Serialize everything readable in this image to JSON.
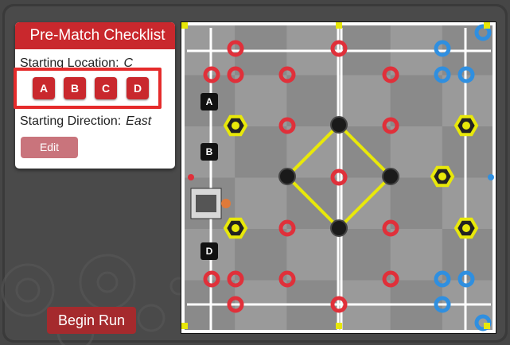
{
  "checklist": {
    "title": "Pre-Match Checklist",
    "starting_location_label": "Starting Location:",
    "starting_location_value": "C",
    "starting_direction_label": "Starting Direction:",
    "starting_direction_value": "East",
    "edit_label": "Edit"
  },
  "location_buttons": [
    "A",
    "B",
    "C",
    "D"
  ],
  "field_start_labels": [
    "A",
    "B",
    "D"
  ],
  "begin_run_label": "Begin Run",
  "colors": {
    "accent_red": "#c9282d",
    "highlight": "#e52b2b",
    "field_background": "#8a8a8a",
    "line_white": "#ffffff",
    "line_yellow": "#e8e80a",
    "ring_red": "#e0303a",
    "ring_blue": "#2f8fe0",
    "goal_yellow": "#e8e80a"
  },
  "icons": [
    "gear-decoration",
    "robot-icon",
    "ring-icon",
    "goal-icon",
    "center-goal-icon"
  ]
}
